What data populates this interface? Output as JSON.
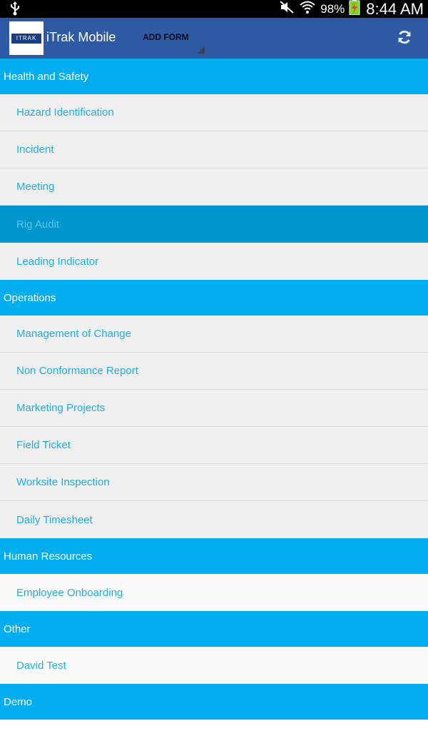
{
  "status_bar": {
    "battery_percent": "98%",
    "time": "8:44 AM"
  },
  "action_bar": {
    "app_title": "iTrak Mobile",
    "logo_text": "ITRAK",
    "spinner_label": "ADD FORM"
  },
  "sections": [
    {
      "title": "Health and Safety",
      "items": [
        "Hazard Identification",
        "Incident",
        "Meeting",
        "Rig Audit",
        "Leading Indicator"
      ]
    },
    {
      "title": "Operations",
      "items": [
        "Management of Change",
        "Non Conformance Report",
        "Marketing Projects",
        "Field Ticket",
        "Worksite Inspection",
        "Daily Timesheet"
      ]
    },
    {
      "title": "Human Resources",
      "items": [
        "Employee Onboarding"
      ]
    },
    {
      "title": "Other",
      "items": [
        "David Test"
      ]
    },
    {
      "title": "Demo",
      "items": []
    }
  ],
  "selected_item": "Rig Audit",
  "colors": {
    "action_bar": "#2e5aa3",
    "section_header": "#00aeef",
    "item_text": "#1faee4",
    "selected_row": "#0097cf"
  }
}
